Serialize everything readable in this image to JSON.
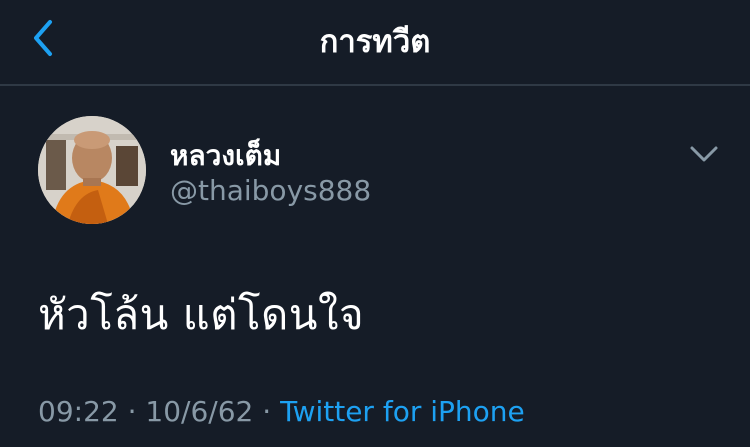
{
  "header": {
    "title": "การทวีต",
    "back_icon": "chevron-left-icon",
    "accent_color": "#1da1f2"
  },
  "tweet": {
    "author": {
      "display_name": "หลวงเต็ม",
      "handle": "@thaiboys888"
    },
    "text": "หัวโล้น แต่โดนใจ",
    "time": "09:22",
    "separator": "·",
    "date": "10/6/62",
    "source": "Twitter for iPhone"
  },
  "colors": {
    "background": "#151c27",
    "secondary_text": "#8899a6",
    "divider": "#2f3945"
  }
}
